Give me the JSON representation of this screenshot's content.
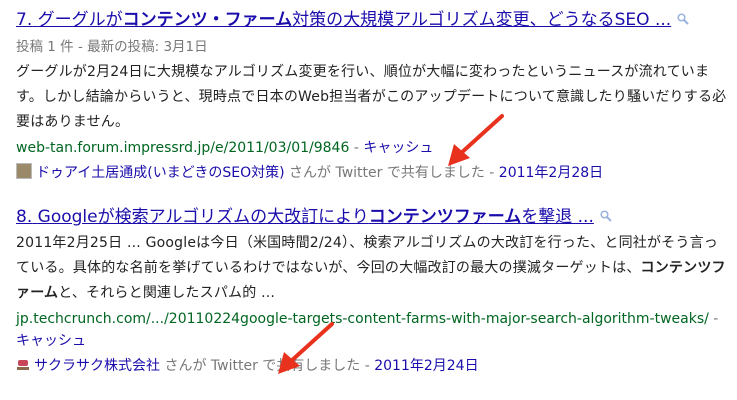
{
  "results": [
    {
      "number": "7.",
      "title_pre": "グーグルが",
      "title_bold": "コンテンツ・ファーム",
      "title_post": "対策の大規模アルゴリズム変更、どうなるSEO ...",
      "meta": "投稿 1 件 - 最新の投稿: 3月1日",
      "snippet": "グーグルが2月24日に大規模なアルゴリズム変更を行い、順位が大幅に変わったというニュースが流れています。しかし結論からいうと、現時点で日本のWeb担当者がこのアップデートについて意識したり騒いだりする必要はありません。",
      "url": "web-tan.forum.impressrd.jp/e/2011/03/01/9846",
      "separator": " - ",
      "cache": "キャッシュ",
      "shared_by": "ドゥアイ土居通成(いまどきのSEO対策)",
      "shared_text": " さんが Twitter で共有しました - ",
      "shared_date": "2011年2月28日"
    },
    {
      "number": "8.",
      "title_pre": "Googleが検索アルゴリズムの大改訂により",
      "title_bold": "コンテンツファーム",
      "title_post": "を撃退 ...",
      "snippet_1": "2011年2月25日 ... Googleは今日（米国時間2/24）、検索アルゴリズムの大改訂を行った、と同社がそう言っている。具体的な名前を挙げているわけではないが、今回の大幅改訂の最大の撲滅ターゲットは、",
      "snippet_bold": "コンテンツファーム",
      "snippet_2": "と、それらと関連したスパム的 ...",
      "url": "jp.techcrunch.com/.../20110224google-targets-content-farms-with-major-search-algorithm-tweaks/",
      "separator": " - ",
      "cache": "キャッシュ",
      "shared_by": "サクラサク株式会社",
      "shared_text": " さんが Twitter で共有しました - ",
      "shared_date": "2011年2月24日"
    }
  ],
  "icons": {
    "magnifier": "magnifier-icon",
    "arrow": "red-arrow-annotation"
  },
  "colors": {
    "link": "#1a0dab",
    "url": "#006621",
    "meta": "#777777",
    "arrow": "#e8321e"
  }
}
